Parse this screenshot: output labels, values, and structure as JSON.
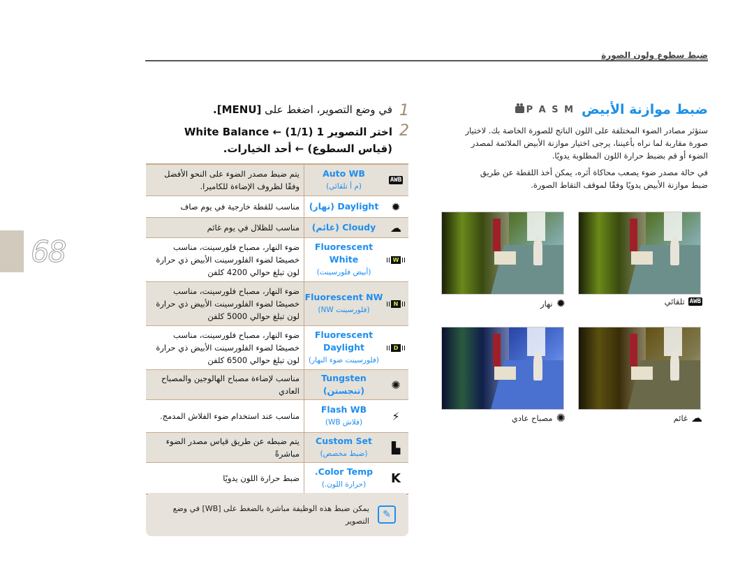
{
  "header": {
    "section_title": "ضبط سطوع ولون الصورة"
  },
  "page": {
    "number": "68"
  },
  "intro": {
    "title": "ضبط موازنة الأبيض",
    "modes": "P A S M",
    "paragraph1": "ستؤثر مصادر الضوء المختلفة على اللون الناتج للصورة الخاصة بك. لاختيار صورة مقاربة لما نراه بأعيننا، يرجى اختيار موازنة الأبيض الملائمة لمصدر الضوء أو قم بضبط حرارة اللون المطلوبة يدويًا.",
    "paragraph2": "في حالة مصدر ضوء يصعب محاكاة أثره، يمكن أخذ اللقطة عن طريق ضبط موازنة الأبيض يدويًا وفقًا لموقف التقاط الصورة."
  },
  "photos": [
    {
      "key": "auto",
      "caption": "تلقائي",
      "icon": "AWB"
    },
    {
      "key": "daylight",
      "caption": "نهار",
      "icon": "sun-icon"
    },
    {
      "key": "cloudy",
      "caption": "غائم",
      "icon": "cloud-icon"
    },
    {
      "key": "tungsten",
      "caption": "مصباح عادي",
      "icon": "bulb-icon"
    }
  ],
  "steps": {
    "step1_num": "1",
    "step1_text": "في وضع التصوير، اضغط على",
    "step1_key": "[MENU].",
    "step2_num": "2",
    "step2_text": "اختر التصوير 1 (1/1) ← White Balance",
    "step2_text2": "(قياس السطوع) ← أحد الخيارات."
  },
  "options": [
    {
      "icon": "AWB",
      "name": "Auto WB",
      "sub": "(م أ تلقائي)",
      "desc": "يتم ضبط مصدر الضوء على النحو الأفضل وفقًا لظروف الإضاءة للكاميرا.",
      "shaded": true
    },
    {
      "icon": "☀",
      "name": "Daylight (نهار)",
      "sub": "",
      "desc": "مناسب للقطة خارجية في يوم صاف",
      "shaded": false
    },
    {
      "icon": "☁",
      "name": "Cloudy (غائم)",
      "sub": "",
      "desc": "مناسب للظلال في يوم غائم",
      "shaded": true
    },
    {
      "icon": "W",
      "name": "Fluorescent White",
      "sub": "(أبيض فلورسينت)",
      "desc": "ضوء النهار، مصباح فلورسينت، مناسب خصيصًا لضوء الفلورسينت الأبيض ذي حرارة لون تبلغ حوالي 4200 كلفن",
      "shaded": false
    },
    {
      "icon": "N",
      "name": "Fluorescent NW",
      "sub": "(فلورسينت NW)",
      "desc": "ضوء النهار، مصباح فلورسينت، مناسب خصيصًا لضوء الفلورسينت الأبيض ذي حرارة لون تبلغ حوالي 5000 كلفن",
      "shaded": true
    },
    {
      "icon": "D",
      "name": "Fluorescent Daylight",
      "sub": "(فلورسينت ضوء النهار)",
      "desc": "ضوء النهار، مصباح فلورسينت، مناسب خصيصًا لضوء الفلورسينت الأبيض ذي حرارة لون تبلغ حوالي 6500 كلفن",
      "shaded": false
    },
    {
      "icon": "✹",
      "name": "Tungsten (تنجستن)",
      "sub": "",
      "desc": "مناسب لإضاءة مصباح الهالوجين والمصباح العادي",
      "shaded": true
    },
    {
      "icon": "⚡",
      "name": "Flash WB",
      "sub": "(فلاش WB)",
      "desc": "مناسب عند استخدام ضوء الفلاش المدمج.",
      "shaded": false
    },
    {
      "icon": "▙",
      "name": "Custom Set",
      "sub": "(ضبط مخصص)",
      "desc": "يتم ضبطه عن طريق قياس مصدر الضوء مباشرةً",
      "shaded": true
    },
    {
      "icon": "K",
      "name": "Color Temp.",
      "sub": "(حرارة اللون.)",
      "desc": "ضبط حرارة اللون يدويًا",
      "shaded": false
    }
  ],
  "note": {
    "text": "يمكن ضبط هذه الوظيفة مباشرة بالضغط على [WB] في وضع التصوير"
  },
  "colors": {
    "accent": "#1e8ef0",
    "table_border": "#c9a98a",
    "shaded_row": "#e5e1d8"
  }
}
